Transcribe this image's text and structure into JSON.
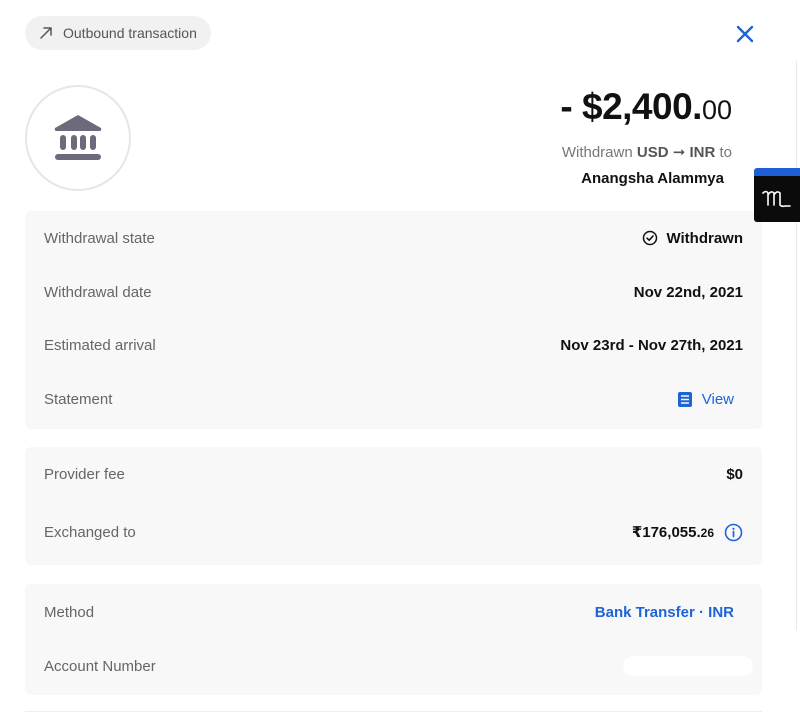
{
  "header": {
    "badge_label": "Outbound transaction",
    "badge_icon": "arrow-up-right-icon",
    "close_icon": "close-icon"
  },
  "summary": {
    "avatar_icon": "bank-icon",
    "amount_main": "- $2,400.",
    "amount_cents": "00",
    "withdrawn_prefix": "Withdrawn",
    "currency_from": "USD",
    "arrow": "➞",
    "currency_to": "INR",
    "to_word": "to",
    "recipient": "Anangsha Alammya"
  },
  "details": {
    "withdrawal_state_label": "Withdrawal state",
    "withdrawal_state_value": "Withdrawn",
    "withdrawal_date_label": "Withdrawal date",
    "withdrawal_date_value": "Nov 22nd, 2021",
    "estimated_arrival_label": "Estimated arrival",
    "estimated_arrival_value": "Nov 23rd - Nov 27th, 2021",
    "statement_label": "Statement",
    "statement_link": "View"
  },
  "fees": {
    "provider_fee_label": "Provider fee",
    "provider_fee_value": "$0",
    "exchanged_label": "Exchanged to",
    "exchanged_main": "₹176,055.",
    "exchanged_cents": "26"
  },
  "method": {
    "method_label": "Method",
    "method_value": "Bank Transfer · INR",
    "account_label": "Account Number"
  },
  "colors": {
    "accent": "#1f63d8",
    "card_bg": "#f8f8f8",
    "badge_bg": "#f1f1f1",
    "bank_icon": "#6b6b7b"
  }
}
